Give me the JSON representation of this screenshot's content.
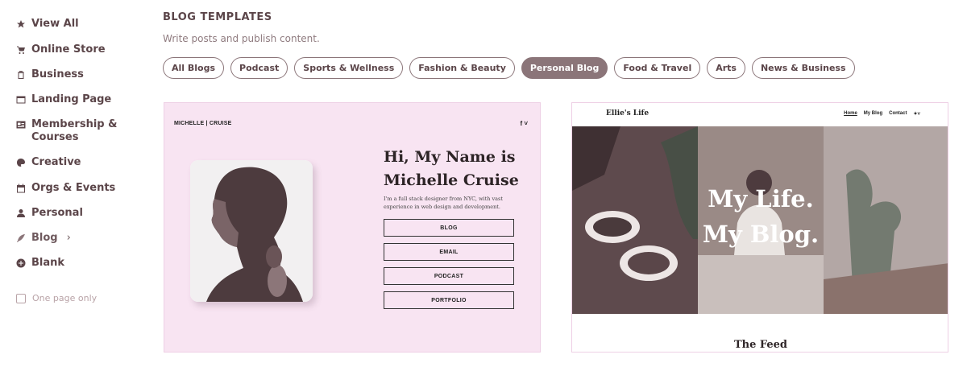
{
  "sidebar": {
    "items": [
      {
        "label": "View All",
        "icon": "star-icon"
      },
      {
        "label": "Online Store",
        "icon": "cart-icon"
      },
      {
        "label": "Business",
        "icon": "clipboard-icon"
      },
      {
        "label": "Landing Page",
        "icon": "window-icon"
      },
      {
        "label": "Membership &",
        "label2": "Courses",
        "icon": "id-card-icon"
      },
      {
        "label": "Creative",
        "icon": "palette-icon"
      },
      {
        "label": "Orgs & Events",
        "icon": "calendar-icon"
      },
      {
        "label": "Personal",
        "icon": "person-icon"
      },
      {
        "label": "Blog",
        "icon": "quill-icon",
        "chevron": "›"
      },
      {
        "label": "Blank",
        "icon": "plus-circle-icon"
      }
    ],
    "one_page_only": "One page only"
  },
  "header": {
    "title": "BLOG TEMPLATES",
    "subtitle": "Write posts and publish content."
  },
  "filters": {
    "items": [
      "All Blogs",
      "Podcast",
      "Sports & Wellness",
      "Fashion & Beauty",
      "Personal Blog",
      "Food & Travel",
      "Arts",
      "News & Business"
    ],
    "selected": "Personal Blog"
  },
  "templates": [
    {
      "brand": "MICHELLE | CRUISE",
      "social": "f ˅",
      "title_line1": "Hi, My Name is",
      "title_line2": "Michelle Cruise",
      "description": "I'm a full stack designer from NYC, with vast experience in web design and development.",
      "buttons": [
        "BLOG",
        "EMAIL",
        "PODCAST",
        "PORTFOLIO"
      ]
    },
    {
      "brand": "Ellie's Life",
      "nav": [
        "Home",
        "My Blog",
        "Contact",
        "✦˅"
      ],
      "headline_line1": "My Life.",
      "headline_line2": "My Blog.",
      "section_title": "The Feed"
    }
  ],
  "colors": {
    "text": "#5b4549",
    "accent": "#8b7579",
    "muted": "#b9a3a7",
    "card_bg_pink": "#f8e4f2"
  }
}
